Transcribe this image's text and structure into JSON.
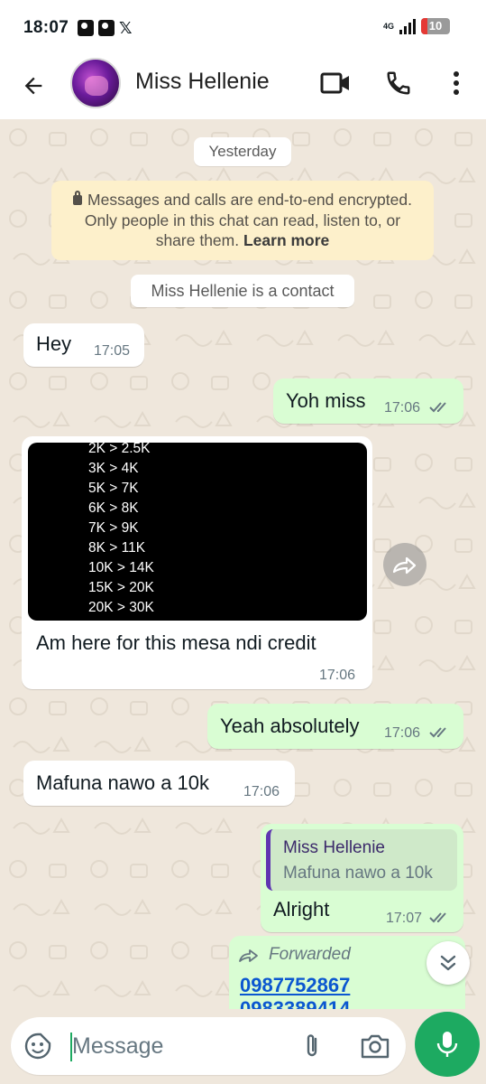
{
  "status_bar": {
    "time": "18:07",
    "network": "4G",
    "battery": "10",
    "notification_icons": [
      "contact-card-icon",
      "contact-card-icon",
      "x-logo-icon"
    ]
  },
  "header": {
    "contact_name": "Miss Hellenie",
    "icons": [
      "back-arrow-icon",
      "video-call-icon",
      "phone-icon",
      "more-vert-icon"
    ]
  },
  "chat": {
    "date_label": "Yesterday",
    "encryption_notice": "Messages and calls are end-to-end encrypted. Only people in this chat can read, listen to, or share them.",
    "encryption_link": "Learn more",
    "contact_notice": "Miss Hellenie is a contact",
    "messages": [
      {
        "dir": "in",
        "text": "Hey",
        "time": "17:05"
      },
      {
        "dir": "out",
        "text": "Yoh miss",
        "time": "17:06",
        "status": "read"
      },
      {
        "dir": "in",
        "image_lines": [
          "2K > 2.5K",
          "3K > 4K",
          "5K > 7K",
          "6K > 8K",
          "7K > 9K",
          "8K > 11K",
          "10K > 14K",
          "15K > 20K",
          "20K > 30K"
        ],
        "text": "Am here for this mesa ndi credit",
        "time": "17:06"
      },
      {
        "dir": "out",
        "text": "Yeah absolutely",
        "time": "17:06",
        "status": "read"
      },
      {
        "dir": "in",
        "text": "Mafuna nawo a 10k",
        "time": "17:06"
      },
      {
        "dir": "out",
        "quote_name": "Miss Hellenie",
        "quote_text": "Mafuna nawo a 10k",
        "text": "Alright",
        "time": "17:07",
        "status": "read"
      },
      {
        "dir": "out",
        "forwarded_label": "Forwarded",
        "links": [
          "0987752867",
          "0983389414"
        ]
      }
    ]
  },
  "composer": {
    "placeholder": "Message",
    "icons": [
      "emoji-sticker-icon",
      "attach-icon",
      "camera-icon",
      "mic-icon"
    ]
  },
  "colors": {
    "chat_background": "#efe7dc",
    "incoming_bubble": "#ffffff",
    "outgoing_bubble": "#d9fdd3",
    "accent_green": "#1daa61",
    "encryption_bg": "#fdf0cb",
    "link_blue": "#0b57d0"
  }
}
